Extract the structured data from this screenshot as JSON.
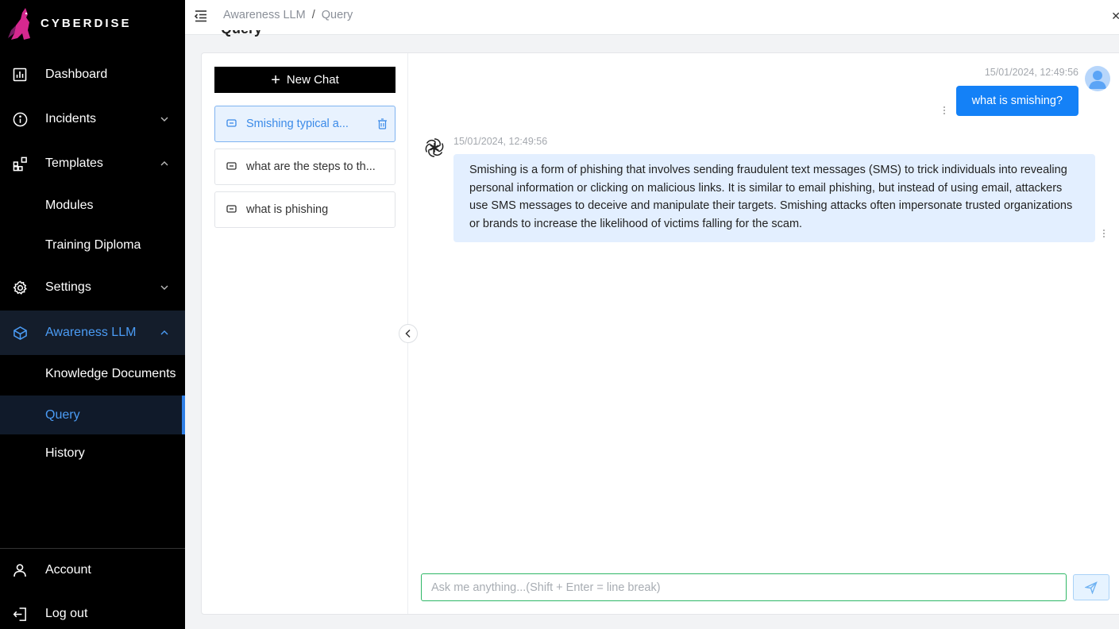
{
  "app": {
    "brand": "CYBERDISE"
  },
  "sidebar": {
    "items": [
      {
        "label": "Dashboard",
        "icon": "dashboard-icon"
      },
      {
        "label": "Incidents",
        "icon": "info-icon"
      },
      {
        "label": "Templates",
        "icon": "templates-icon"
      },
      {
        "label": "Modules"
      },
      {
        "label": "Training Diploma"
      },
      {
        "label": "Settings",
        "icon": "gear-icon"
      },
      {
        "label": "Awareness LLM",
        "icon": "llm-icon"
      },
      {
        "label": "Knowledge Documents"
      },
      {
        "label": "Query"
      },
      {
        "label": "History"
      }
    ],
    "account_label": "Account",
    "logout_label": "Log out"
  },
  "header": {
    "breadcrumb": [
      "Awareness LLM",
      "/",
      "Query"
    ]
  },
  "chats": {
    "new_chat_label": "New Chat",
    "list": [
      {
        "title": "Smishing typical a..."
      },
      {
        "title": "what are the steps to th..."
      },
      {
        "title": "what is phishing"
      }
    ]
  },
  "conversation": {
    "user_message": {
      "time": "15/01/2024, 12:49:56",
      "text": "what is smishing?"
    },
    "bot_message": {
      "time": "15/01/2024, 12:49:56",
      "text": "Smishing is a form of phishing that involves sending fraudulent text messages (SMS) to trick individuals into revealing personal information or clicking on malicious links. It is similar to email phishing, but instead of using email, attackers use SMS messages to deceive and manipulate their targets. Smishing attacks often impersonate trusted organizations or brands to increase the likelihood of victims falling for the scam."
    }
  },
  "composer": {
    "placeholder": "Ask me anything...(Shift + Enter = line break)",
    "value": ""
  },
  "colors": {
    "accent": "#1481f7",
    "active_nav": "#4b9cf5",
    "bot_bubble": "#e3efff",
    "input_border": "#2fb766"
  }
}
